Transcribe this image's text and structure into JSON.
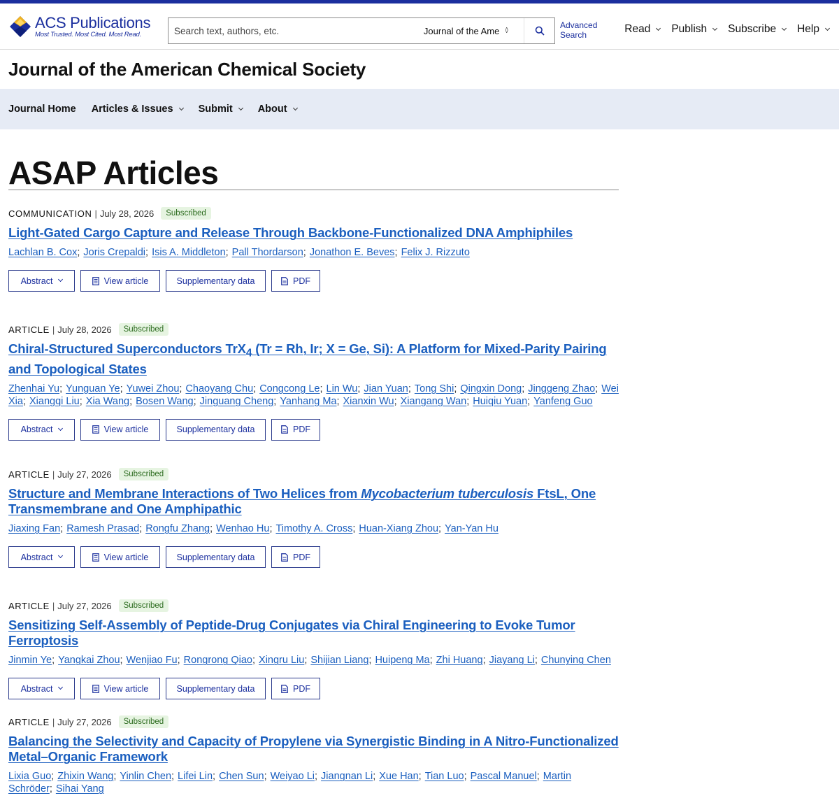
{
  "brand": {
    "name": "ACS Publications",
    "tagline": "Most Trusted. Most Cited. Most Read."
  },
  "search": {
    "placeholder": "Search text, authors, etc.",
    "scope": "Journal of the Ame",
    "advanced_label": "Advanced Search"
  },
  "topnav": [
    {
      "label": "Read"
    },
    {
      "label": "Publish"
    },
    {
      "label": "Subscribe"
    },
    {
      "label": "Help"
    }
  ],
  "journal_title": "Journal of the American Chemical Society",
  "subnav": [
    {
      "label": "Journal Home",
      "has_menu": false
    },
    {
      "label": "Articles & Issues",
      "has_menu": true
    },
    {
      "label": "Submit",
      "has_menu": true
    },
    {
      "label": "About",
      "has_menu": true
    }
  ],
  "page_title": "ASAP Articles",
  "buttons": {
    "abstract": "Abstract",
    "view": "View article",
    "supplementary": "Supplementary data",
    "pdf": "PDF"
  },
  "articles": [
    {
      "type": "COMMUNICATION",
      "date": "July 28, 2026",
      "badge": "Subscribed",
      "title": "Light-Gated Cargo Capture and Release Through Backbone-Functionalized DNA Amphiphiles",
      "authors": [
        "Lachlan B. Cox",
        "Joris Crepaldi",
        "Isis A. Middleton",
        "Pall Thordarson",
        "Jonathon E. Beves",
        "Felix J. Rizzuto"
      ]
    },
    {
      "type": "ARTICLE",
      "date": "July 28, 2026",
      "badge": "Subscribed",
      "title_html": "Chiral-Structured Superconductors TrX<sub>4</sub> (Tr = Rh, Ir; X = Ge, Si): A Platform for Mixed-Parity Pairing and Topological States",
      "authors": [
        "Zhenhai Yu",
        "Yunguan Ye",
        "Yuwei Zhou",
        "Chaoyang Chu",
        "Congcong Le",
        "Lin Wu",
        "Jian Yuan",
        "Tong Shi",
        "Qingxin Dong",
        "Jinggeng Zhao",
        "Wei Xia",
        "Xiangqi Liu",
        "Xia Wang",
        "Bosen Wang",
        "Jinguang Cheng",
        "Yanhang Ma",
        "Xianxin Wu",
        "Xiangang Wan",
        "Huiqiu Yuan",
        "Yanfeng Guo"
      ]
    },
    {
      "type": "ARTICLE",
      "date": "July 27, 2026",
      "badge": "Subscribed",
      "title_html": "Structure and Membrane Interactions of Two Helices from <i>Mycobacterium tuberculosis</i> FtsL, One Transmembrane and One Amphipathic",
      "authors": [
        "Jiaxing Fan",
        "Ramesh Prasad",
        "Rongfu Zhang",
        "Wenhao Hu",
        "Timothy A. Cross",
        "Huan-Xiang Zhou",
        "Yan-Yan Hu"
      ]
    },
    {
      "type": "ARTICLE",
      "date": "July 27, 2026",
      "badge": "Subscribed",
      "title": "Sensitizing Self-Assembly of Peptide-Drug Conjugates via Chiral Engineering to Evoke Tumor Ferroptosis",
      "authors": [
        "Jinmin Ye",
        "Yangkai Zhou",
        "Wenjiao Fu",
        "Rongrong Qiao",
        "Xingru Liu",
        "Shijian Liang",
        "Huipeng Ma",
        "Zhi Huang",
        "Jiayang Li",
        "Chunying Chen"
      ]
    },
    {
      "type": "ARTICLE",
      "date": "July 27, 2026",
      "badge": "Subscribed",
      "title": "Balancing the Selectivity and Capacity of Propylene via Synergistic Binding in A Nitro-Functionalized Metal–Organic Framework",
      "authors": [
        "Lixia Guo",
        "Zhixin Wang",
        "Yinlin Chen",
        "Lifei Lin",
        "Chen Sun",
        "Weiyao Li",
        "Jiangnan Li",
        "Xue Han",
        "Tian Luo",
        "Pascal Manuel",
        "Martin Schröder",
        "Sihai Yang"
      ]
    }
  ],
  "colors": {
    "brand_blue": "#1b2f9e",
    "link_blue": "#1b5fbf",
    "subnav_bg": "#e6ebf5",
    "badge_bg": "#e6f4e1",
    "badge_text": "#2b6b1e"
  },
  "icons": {
    "logo": "acs-diamond-logo",
    "search": "search-icon",
    "scope": "sort-arrows-icon",
    "menu": "chevron-down-icon",
    "document": "document-icon",
    "pdf": "pdf-icon"
  }
}
